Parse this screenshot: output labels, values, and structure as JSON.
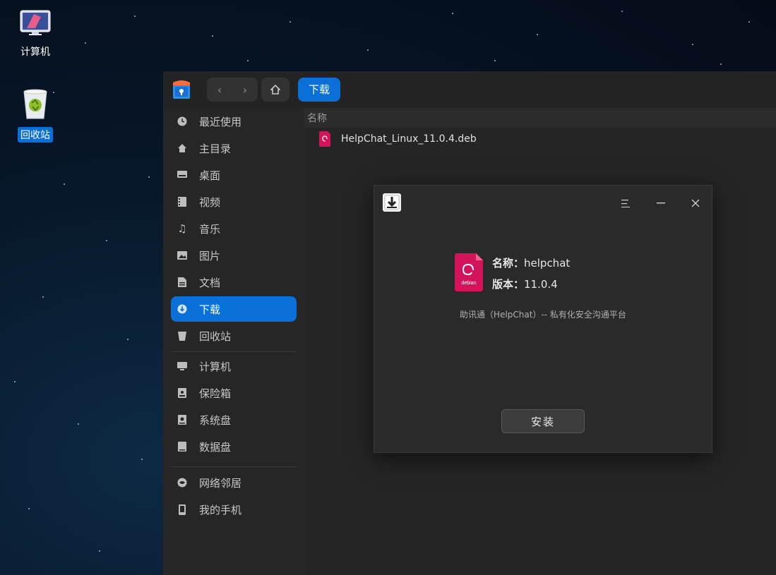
{
  "desktop": {
    "icons": [
      {
        "label": "计算机"
      },
      {
        "label": "回收站"
      }
    ]
  },
  "file_manager": {
    "breadcrumb": "下载",
    "sidebar": {
      "items": [
        {
          "label": "最近使用",
          "icon": "clock-icon"
        },
        {
          "label": "主目录",
          "icon": "home-icon"
        },
        {
          "label": "桌面",
          "icon": "desktop-icon"
        },
        {
          "label": "视频",
          "icon": "video-icon"
        },
        {
          "label": "音乐",
          "icon": "music-icon"
        },
        {
          "label": "图片",
          "icon": "picture-icon"
        },
        {
          "label": "文档",
          "icon": "document-icon"
        },
        {
          "label": "下载",
          "icon": "download-icon",
          "active": true
        },
        {
          "label": "回收站",
          "icon": "trash-icon"
        },
        {
          "label": "计算机",
          "icon": "computer-icon"
        },
        {
          "label": "保险箱",
          "icon": "vault-icon"
        },
        {
          "label": "系统盘",
          "icon": "disk-icon"
        },
        {
          "label": "数据盘",
          "icon": "disk-icon"
        },
        {
          "label": "网络邻居",
          "icon": "network-icon"
        },
        {
          "label": "我的手机",
          "icon": "phone-icon"
        }
      ]
    },
    "columns": {
      "name": "名称"
    },
    "files": [
      {
        "name": "HelpChat_Linux_11.0.4.deb",
        "icon": "deb-package-icon"
      }
    ]
  },
  "installer": {
    "name_key": "名称：",
    "name_value": "helpchat",
    "version_key": "版本：",
    "version_value": "11.0.4",
    "package_icon_text": "debian",
    "description": "助讯通（HelpChat）-- 私有化安全沟通平台",
    "install_label": "安装"
  },
  "colors": {
    "accent": "#0a6fd6",
    "debian_pink": "#d4145a",
    "window_bg": "#252525"
  }
}
